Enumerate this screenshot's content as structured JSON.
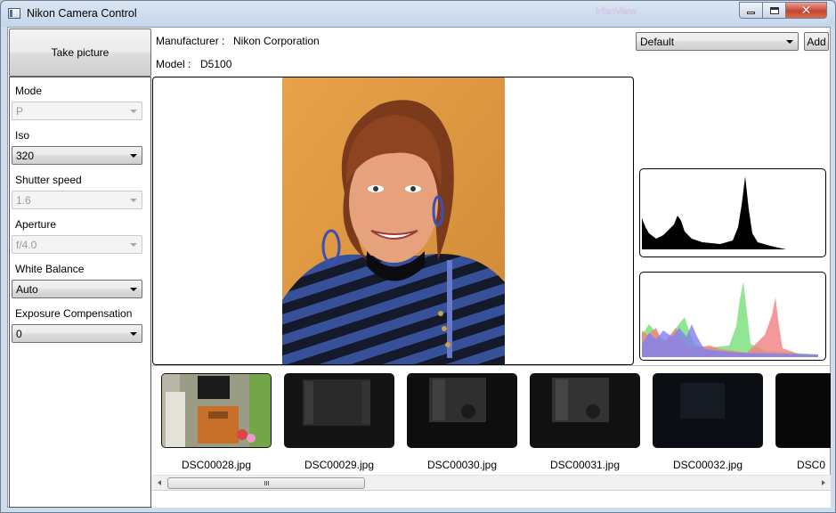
{
  "window": {
    "title": "Nikon Camera Control",
    "background_title": "IrfanView"
  },
  "camera": {
    "manufacturer_label": "Manufacturer :",
    "manufacturer_value": "Nikon Corporation",
    "model_label": "Model :",
    "model_value": "D5100"
  },
  "presets": {
    "selected": "Default",
    "add_label": "Add"
  },
  "take_picture_label": "Take picture",
  "settings": [
    {
      "label": "Mode",
      "value": "P",
      "enabled": false
    },
    {
      "label": "Iso",
      "value": "320",
      "enabled": true
    },
    {
      "label": "Shutter speed",
      "value": "1.6",
      "enabled": false
    },
    {
      "label": "Aperture",
      "value": "f/4.0",
      "enabled": false
    },
    {
      "label": "White Balance",
      "value": "Auto",
      "enabled": true
    },
    {
      "label": "Exposure Compensation",
      "value": "0",
      "enabled": true
    }
  ],
  "thumbnails": [
    {
      "name": "DSC00028.jpg"
    },
    {
      "name": "DSC00029.jpg"
    },
    {
      "name": "DSC00030.jpg"
    },
    {
      "name": "DSC00031.jpg"
    },
    {
      "name": "DSC00032.jpg"
    },
    {
      "name": "DSC0"
    }
  ],
  "colors": {
    "red_channel": "#f08080",
    "green_channel": "#7fe07f",
    "blue_channel": "#7f7ff0"
  }
}
